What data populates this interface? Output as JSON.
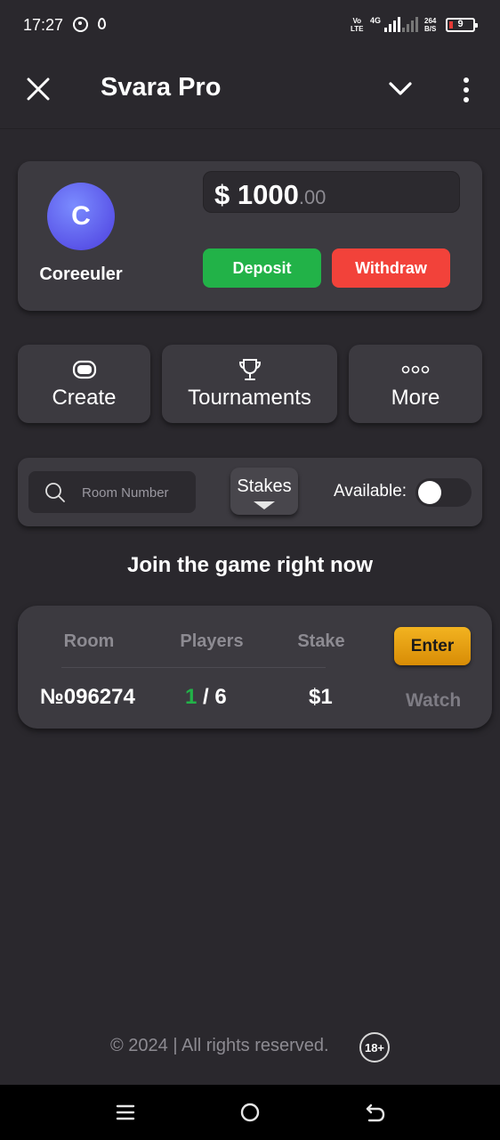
{
  "status_bar": {
    "time": "17:27",
    "network_top": "Vo",
    "network_bottom": "LTE",
    "net_type": "4G",
    "speed_top": "264",
    "speed_bottom": "B/S",
    "battery": "9"
  },
  "header": {
    "title": "Svara Pro",
    "icons": [
      "close-icon",
      "chevron-down-icon",
      "kebab-icon"
    ]
  },
  "profile": {
    "avatar_letter": "C",
    "username": "Coreeuler",
    "balance_main": "$ 1000",
    "balance_cents": ".00",
    "deposit_label": "Deposit",
    "withdraw_label": "Withdraw"
  },
  "actions": {
    "create_label": "Create",
    "tournaments_label": "Tournaments",
    "more_label": "More"
  },
  "filters": {
    "search_placeholder": "Room Number",
    "search_value": "",
    "stakes_label": "Stakes",
    "available_label": "Available:",
    "available_on": false
  },
  "join_heading": "Join the game right now",
  "room_table": {
    "columns": [
      "Room",
      "Players",
      "Stake"
    ],
    "enter_label": "Enter",
    "rows": [
      {
        "room": "№096274",
        "players_current": "1",
        "players_max": " / 6",
        "stake": "$1",
        "watch_label": "Watch"
      }
    ]
  },
  "footer": {
    "copyright": "© 2024 | All rights reserved.",
    "age_badge": "18+"
  },
  "colors": {
    "background": "#2a282d",
    "card": "#3c3a40",
    "deposit": "#22b248",
    "withdraw": "#f2423a",
    "enter": "#f2b320",
    "avatar": "#5a55e8"
  }
}
